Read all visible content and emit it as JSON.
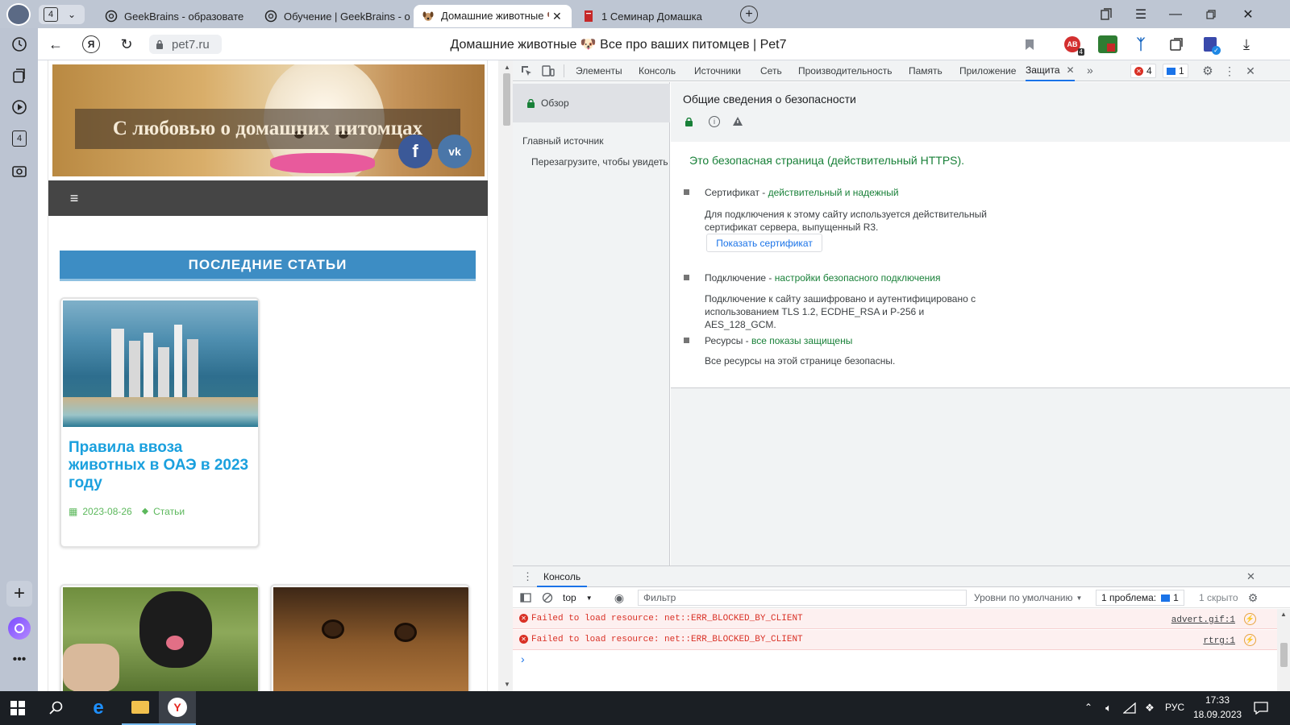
{
  "tabbar": {
    "tab_count": "4",
    "tabs": [
      {
        "label": "GeekBrains - образовате"
      },
      {
        "label": "Обучение | GeekBrains - о"
      },
      {
        "label": "Домашние животные 🐶"
      },
      {
        "label": "1 Семинар Домашка"
      }
    ]
  },
  "address": {
    "url": "pet7.ru",
    "title": "Домашние животные 🐶 Все про ваших питомцев | Pet7",
    "ext_badge": "4"
  },
  "sidebar": {
    "badge": "4"
  },
  "site": {
    "banner_text": "С любовью о домашних питомцах",
    "section_title": "ПОСЛЕДНИЕ СТАТЬИ",
    "article": {
      "title": "Правила ввоза животных в ОАЭ в 2023 году",
      "date": "2023-08-26",
      "category": "Статьи"
    }
  },
  "devtools": {
    "tabs": [
      "Элементы",
      "Консоль",
      "Источники",
      "Сеть",
      "Производительность",
      "Память",
      "Приложение",
      "Защита"
    ],
    "error_count": "4",
    "message_count": "1",
    "security": {
      "nav_overview": "Обзор",
      "nav_main_origin": "Главный источник",
      "nav_reload_hint": "Перезагрузите, чтобы увидеть г",
      "heading": "Общие сведения о безопасности",
      "secure_text": "Это безопасная страница (действительный HTTPS).",
      "cert_label": "Сертификат - ",
      "cert_status": "действительный и надежный",
      "cert_desc": "Для подключения к этому сайту используется действительный сертификат сервера, выпущенный R3.",
      "cert_button": "Показать сертификат",
      "conn_label": "Подключение - ",
      "conn_status": "настройки безопасного подключения",
      "conn_desc": "Подключение к сайту зашифровано и аутентифицировано с использованием TLS 1.2, ECDHE_RSA и P-256 и AES_128_GCM.",
      "res_label": "Ресурсы - ",
      "res_status": "все показы защищены",
      "res_desc": "Все ресурсы на этой странице безопасны."
    },
    "console": {
      "title": "Консоль",
      "context": "top",
      "filter_placeholder": "Фильтр",
      "levels": "Уровни по умолчанию",
      "issues_label": "1 проблема:",
      "issues_count": "1",
      "hidden": "1 скрыто",
      "errors": [
        {
          "text": "Failed to load resource: net::ERR_BLOCKED_BY_CLIENT",
          "source": "advert.gif:1"
        },
        {
          "text": "Failed to load resource: net::ERR_BLOCKED_BY_CLIENT",
          "source": "rtrg:1"
        }
      ],
      "prompt": "›"
    }
  },
  "taskbar": {
    "lang": "РУС",
    "time": "17:33",
    "date": "18.09.2023"
  },
  "colors": {
    "accent_blue": "#3d8dc4",
    "link_blue": "#1aa0de",
    "meta_green": "#5cb85c",
    "secure_green": "#188038",
    "error_red": "#d93025"
  }
}
